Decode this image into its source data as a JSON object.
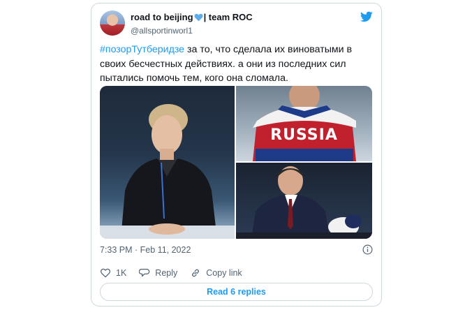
{
  "tweet": {
    "display_name_part1": "road to beijing",
    "display_name_part2": "| team ROC",
    "handle": "@allsportinworl1",
    "text_hashtag": "#позорТутберидзе",
    "text_body": " за то, что сделала их виноватыми в своих бесчестных действиях. а они из последних сил пытались помочь тем, кого она сломала.",
    "media_text_russia": "RUSSIA",
    "timestamp": "7:33 PM · Feb 11, 2022",
    "like_count": "1K",
    "reply_label": "Reply",
    "copy_link_label": "Copy link",
    "read_replies_label": "Read 6 replies"
  },
  "icons": {
    "brand": "twitter-bird-icon",
    "heart_emoji": "blue-heart-icon",
    "info": "info-icon",
    "like": "heart-icon",
    "reply": "reply-bubble-icon",
    "copy": "link-icon"
  },
  "colors": {
    "accent": "#1d9bf0",
    "text": "#0f1419",
    "secondary": "#536471",
    "border": "#cfd9de",
    "emoji_heart": "#5dadec"
  }
}
